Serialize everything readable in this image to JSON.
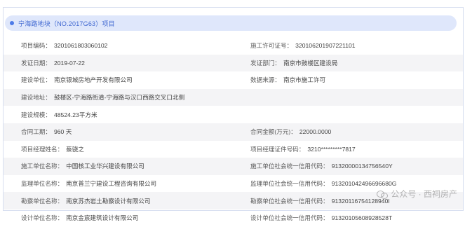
{
  "header": {
    "title": "宁海路地块（NO.2017G63）项目"
  },
  "rows": [
    {
      "left": {
        "label": "项目编码：",
        "value": "3201061803060102"
      },
      "right": {
        "label": "施工许可证号：",
        "value": "320106201907221101"
      }
    },
    {
      "left": {
        "label": "发证日期：",
        "value": "2019-07-22"
      },
      "right": {
        "label": "发证部门：",
        "value": "南京市鼓楼区建设局"
      }
    },
    {
      "left": {
        "label": "建设单位：",
        "value": "南京银城房地产开发有限公司"
      },
      "right": {
        "label": "数据来源：",
        "value": "南京市施工许可"
      }
    },
    {
      "full": {
        "label": "建设地址：",
        "value": "鼓楼区-宁海路街道-宁海路与汉口西路交叉口北侧"
      }
    },
    {
      "full": {
        "label": "建设规模：",
        "value": "48524.23平方米"
      }
    },
    {
      "left": {
        "label": "合同工期：",
        "value": "960 天"
      },
      "right": {
        "label": "合同金额(万元)：",
        "value": "22000.0000"
      }
    },
    {
      "left": {
        "label": "项目经理姓名：",
        "value": "蔡骁之"
      },
      "right": {
        "label": "项目经理证件号码：",
        "value": "3210*********7817"
      }
    },
    {
      "left": {
        "label": "施工单位名称：",
        "value": "中国核工业华兴建设有限公司"
      },
      "right": {
        "label": "施工单位社会统一信用代码：",
        "value": "91320000134756540Y"
      }
    },
    {
      "left": {
        "label": "监理单位名称：",
        "value": "南京普兰宁建设工程咨询有限公司"
      },
      "right": {
        "label": "监理单位社会统一信用代码：",
        "value": "913201042496696680G"
      }
    },
    {
      "left": {
        "label": "勘察单位名称：",
        "value": "南京苏杰岩土勘察设计有限公司"
      },
      "right": {
        "label": "勘察单位社会统一信用代码：",
        "value": "91320116754128940I"
      }
    },
    {
      "left": {
        "label": "设计单位名称：",
        "value": "南京金宸建筑设计有限公司"
      },
      "right": {
        "label": "设计单位社会统一信用代码：",
        "value": "91320105608928528T"
      }
    }
  ],
  "watermark": {
    "text": "公众号 · 西祠房产"
  }
}
